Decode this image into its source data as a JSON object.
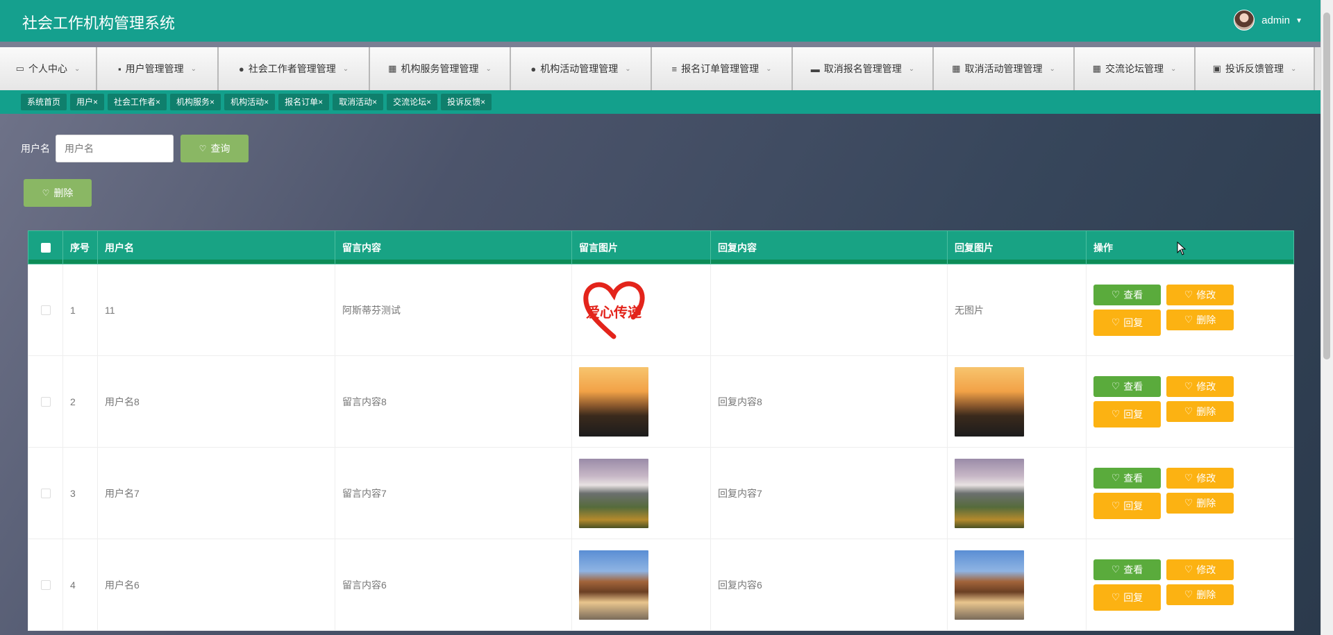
{
  "header": {
    "app_title": "社会工作机构管理系统",
    "user_name": "admin",
    "user_caret": "▾"
  },
  "menu": [
    {
      "icon": "▭",
      "label": "个人中心"
    },
    {
      "icon": "▪",
      "label": "用户管理管理"
    },
    {
      "icon": "●",
      "label": "社会工作者管理管理"
    },
    {
      "icon": "▦",
      "label": "机构服务管理管理"
    },
    {
      "icon": "●",
      "label": "机构活动管理管理"
    },
    {
      "icon": "≡",
      "label": "报名订单管理管理"
    },
    {
      "icon": "▬",
      "label": "取消报名管理管理"
    },
    {
      "icon": "▦",
      "label": "取消活动管理管理"
    },
    {
      "icon": "▦",
      "label": "交流论坛管理"
    },
    {
      "icon": "▣",
      "label": "投诉反馈管理"
    }
  ],
  "menu_chevron": "⌄",
  "tags": [
    "系统首页",
    "用户×",
    "社会工作者×",
    "机构服务×",
    "机构活动×",
    "报名订单×",
    "取消活动×",
    "交流论坛×",
    "投诉反馈×"
  ],
  "search": {
    "label": "用户名",
    "placeholder": "用户名",
    "query_label": "查询"
  },
  "delete_label": "删除",
  "table": {
    "headers": [
      "序号",
      "用户名",
      "留言内容",
      "留言图片",
      "回复内容",
      "回复图片",
      "操作"
    ],
    "rows": [
      {
        "index": "1",
        "username": "11",
        "message": "阿斯蒂芬测试",
        "message_image": "爱心传递",
        "reply": "",
        "reply_image": "无图片"
      },
      {
        "index": "2",
        "username": "用户名8",
        "message": "留言内容8",
        "message_image": "sunset",
        "reply": "回复内容8",
        "reply_image": "sunset"
      },
      {
        "index": "3",
        "username": "用户名7",
        "message": "留言内容7",
        "message_image": "mountain",
        "reply": "回复内容7",
        "reply_image": "mountain"
      },
      {
        "index": "4",
        "username": "用户名6",
        "message": "留言内容6",
        "message_image": "city",
        "reply": "回复内容6",
        "reply_image": "city"
      }
    ],
    "actions": {
      "view": "查看",
      "edit": "修改",
      "reply": "回复",
      "delete": "删除"
    }
  },
  "icons": {
    "heart": "♡"
  },
  "colors": {
    "brand": "#15a08e",
    "button_green": "#8ab764",
    "view_green": "#5aab3c",
    "warning_orange": "#fcb212"
  }
}
